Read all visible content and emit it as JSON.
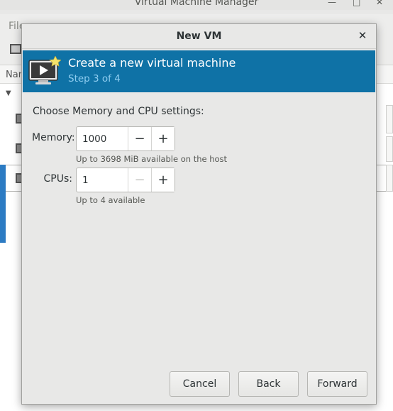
{
  "background_window": {
    "title": "Virtual Machine Manager",
    "minimize_glyph": "—",
    "maximize_glyph": "□",
    "close_glyph": "✕",
    "menu_partial": "File",
    "column_header_partial": "Nam"
  },
  "dialog": {
    "title": "New VM",
    "close_glyph": "✕",
    "banner": {
      "title": "Create a new virtual machine",
      "step": "Step 3 of 4",
      "icon": "monitor-play-icon"
    },
    "section_label": "Choose Memory and CPU settings:",
    "memory": {
      "label": "Memory:",
      "value": "1000",
      "decrement": "−",
      "increment": "+",
      "hint": "Up to 3698 MiB available on the host"
    },
    "cpus": {
      "label": "CPUs:",
      "value": "1",
      "decrement": "−",
      "increment": "+",
      "decrement_disabled": true,
      "hint": "Up to 4 available"
    },
    "buttons": {
      "cancel": "Cancel",
      "back": "Back",
      "forward": "Forward"
    }
  },
  "colors": {
    "banner_bg": "#0f72a6",
    "banner_sub": "#8fcdf0",
    "selection": "#3584e4"
  }
}
